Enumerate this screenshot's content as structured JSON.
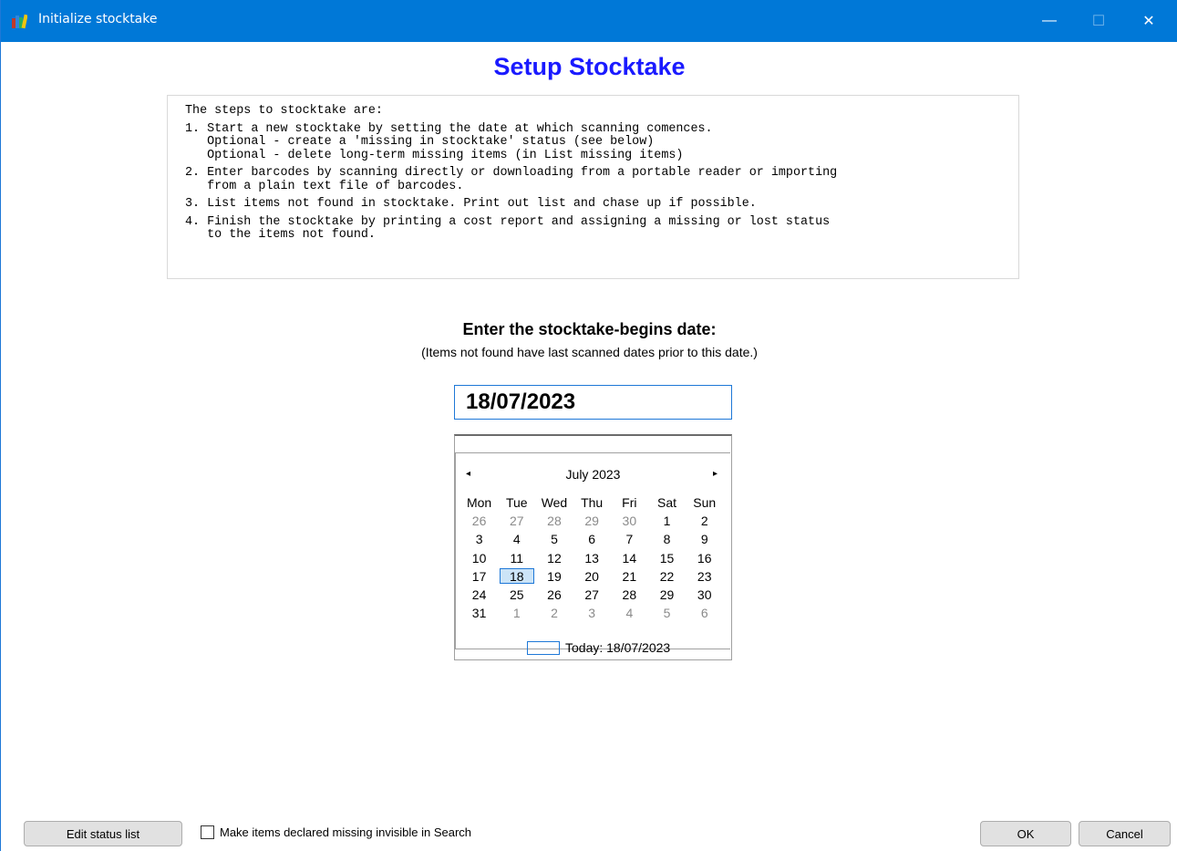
{
  "window": {
    "title": "Initialize stocktake",
    "controls": {
      "minimize": "—",
      "maximize": "☐",
      "close": "✕"
    }
  },
  "heading": "Setup Stocktake",
  "steps": {
    "intro": "The steps to stocktake are:",
    "step1": "1. Start a new stocktake by setting the date at which scanning comences.\n   Optional - create a 'missing in stocktake' status (see below)\n   Optional - delete long-term missing items (in List missing items)",
    "step2": "2. Enter barcodes by scanning directly or downloading from a portable reader or importing\n   from a plain text file of barcodes.",
    "step3": "3. List items not found in stocktake. Print out list and chase up if possible.",
    "step4": "4. Finish the stocktake by printing a cost report and assigning a missing or lost status\n   to the items not found."
  },
  "date_prompt": {
    "title": "Enter the stocktake-begins date:",
    "subtitle": "(Items not found have last scanned dates prior to this date.)",
    "value": "18/07/2023"
  },
  "calendar": {
    "month_label": "July 2023",
    "prev": "◂",
    "next": "▸",
    "weekdays": [
      "Mon",
      "Tue",
      "Wed",
      "Thu",
      "Fri",
      "Sat",
      "Sun"
    ],
    "days": [
      [
        "26",
        "27",
        "28",
        "29",
        "30",
        "1",
        "2"
      ],
      [
        "3",
        "4",
        "5",
        "6",
        "7",
        "8",
        "9"
      ],
      [
        "10",
        "11",
        "12",
        "13",
        "14",
        "15",
        "16"
      ],
      [
        "17",
        "18",
        "19",
        "20",
        "21",
        "22",
        "23"
      ],
      [
        "24",
        "25",
        "26",
        "27",
        "28",
        "29",
        "30"
      ],
      [
        "31",
        "1",
        "2",
        "3",
        "4",
        "5",
        "6"
      ]
    ],
    "selected_day": "18",
    "today_label": "Today: 18/07/2023"
  },
  "footer": {
    "edit_status_label": "Edit status list",
    "checkbox_label": "Make items declared missing invisible in Search",
    "checkbox_checked": false,
    "ok_label": "OK",
    "cancel_label": "Cancel"
  }
}
